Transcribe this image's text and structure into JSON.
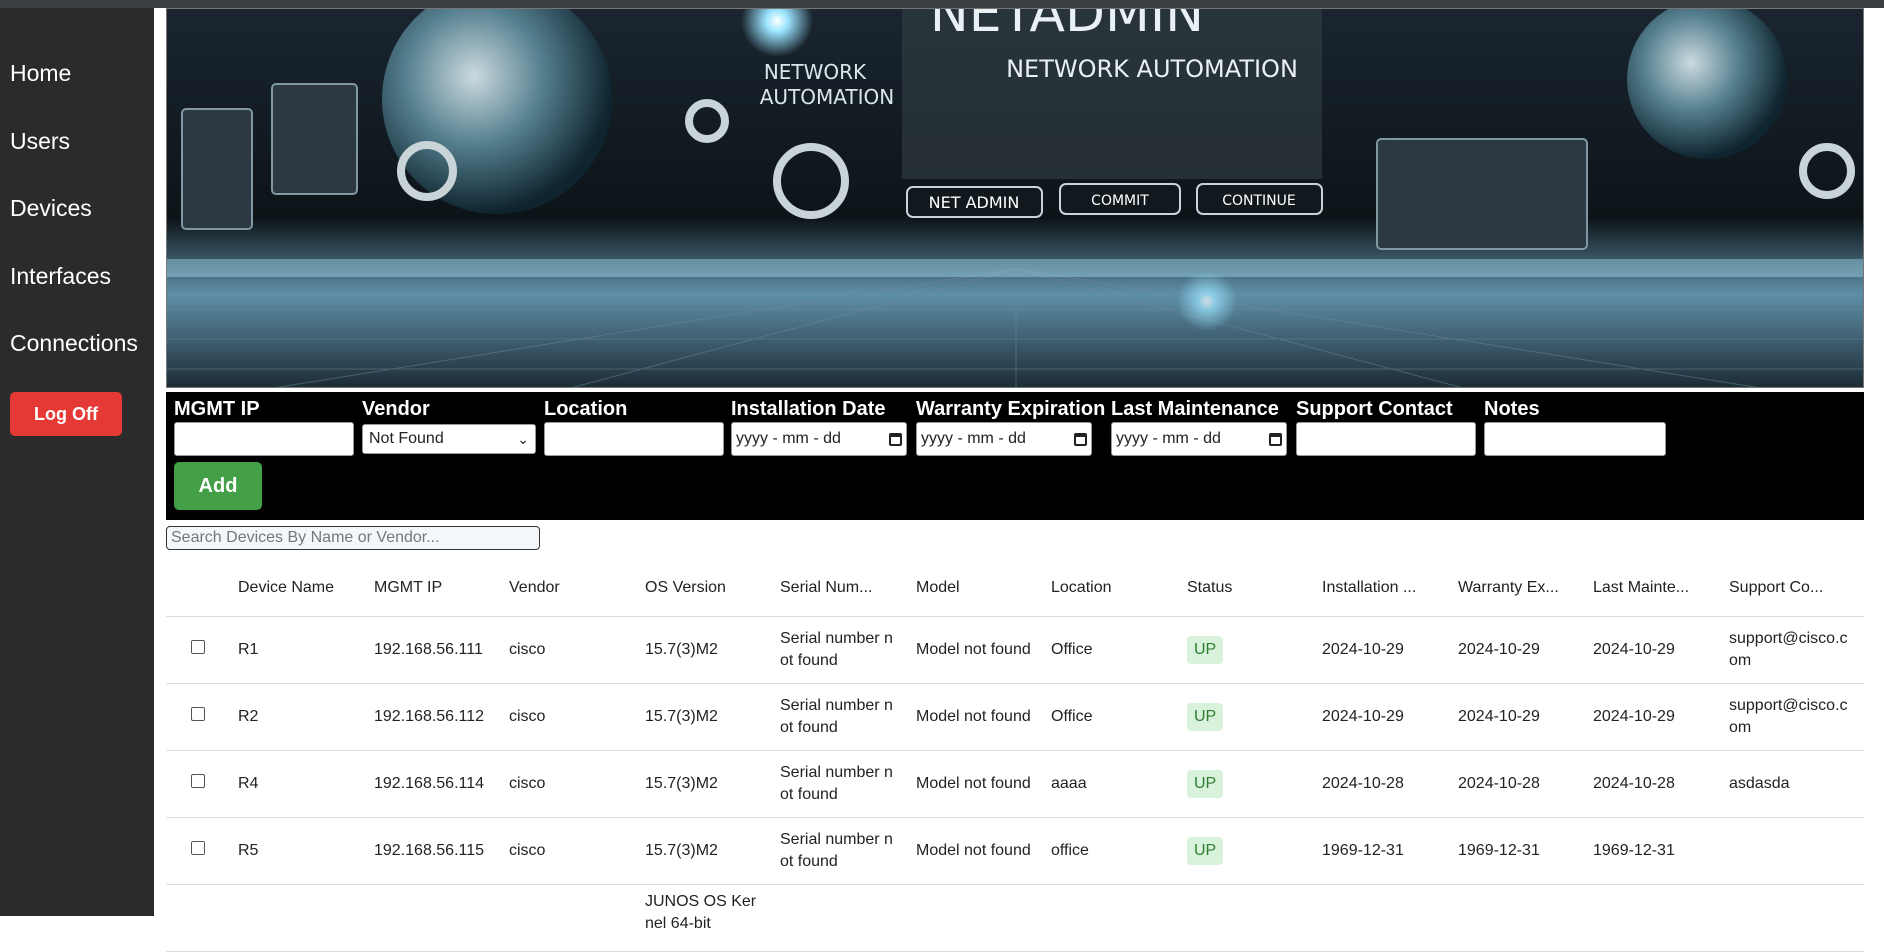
{
  "sidebar": {
    "items": [
      {
        "label": "Home"
      },
      {
        "label": "Users"
      },
      {
        "label": "Devices"
      },
      {
        "label": "Interfaces"
      },
      {
        "label": "Connections"
      }
    ],
    "logoff_label": "Log Off"
  },
  "banner": {
    "title": "NETADMIN",
    "subtitle": "NETWORK AUTOMATION",
    "left_text_line1": "NETWORK",
    "left_text_line2": "AUTOMATION",
    "buttons": [
      "NET ADMIN",
      "COMMIT",
      "CONTINUE"
    ]
  },
  "form": {
    "fields": [
      {
        "label": "MGMT IP",
        "value": ""
      },
      {
        "label": "Vendor",
        "value": "Not Found"
      },
      {
        "label": "Location",
        "value": ""
      },
      {
        "label": "Installation Date",
        "value": "yyyy - mm - dd"
      },
      {
        "label": "Warranty Expiration",
        "value": "yyyy - mm - dd"
      },
      {
        "label": "Last Maintenance",
        "value": "yyyy - mm - dd"
      },
      {
        "label": "Support Contact",
        "value": ""
      },
      {
        "label": "Notes",
        "value": ""
      }
    ],
    "add_label": "Add"
  },
  "search": {
    "placeholder": "Search Devices By Name or Vendor..."
  },
  "table": {
    "headers": [
      "Device Name",
      "MGMT IP",
      "Vendor",
      "OS Version",
      "Serial Num...",
      "Model",
      "Location",
      "Status",
      "Installation ...",
      "Warranty Ex...",
      "Last Mainte...",
      "Support Co..."
    ],
    "rows": [
      {
        "name": "R1",
        "ip": "192.168.56.111",
        "vendor": "cisco",
        "os": "15.7(3)M2",
        "serial": "Serial number not found",
        "model": "Model not found",
        "location": "Office",
        "status": "UP",
        "install": "2024-10-29",
        "warranty": "2024-10-29",
        "maint": "2024-10-29",
        "support": "support@cisco.com"
      },
      {
        "name": "R2",
        "ip": "192.168.56.112",
        "vendor": "cisco",
        "os": "15.7(3)M2",
        "serial": "Serial number not found",
        "model": "Model not found",
        "location": "Office",
        "status": "UP",
        "install": "2024-10-29",
        "warranty": "2024-10-29",
        "maint": "2024-10-29",
        "support": "support@cisco.com"
      },
      {
        "name": "R4",
        "ip": "192.168.56.114",
        "vendor": "cisco",
        "os": "15.7(3)M2",
        "serial": "Serial number not found",
        "model": "Model not found",
        "location": "aaaa",
        "status": "UP",
        "install": "2024-10-28",
        "warranty": "2024-10-28",
        "maint": "2024-10-28",
        "support": "asdasda"
      },
      {
        "name": "R5",
        "ip": "192.168.56.115",
        "vendor": "cisco",
        "os": "15.7(3)M2",
        "serial": "Serial number not found",
        "model": "Model not found",
        "location": "office",
        "status": "UP",
        "install": "1969-12-31",
        "warranty": "1969-12-31",
        "maint": "1969-12-31",
        "support": ""
      },
      {
        "name": "",
        "ip": "",
        "vendor": "",
        "os": "JUNOS OS Kernel 64-bit",
        "serial": "",
        "model": "",
        "location": "",
        "status": "",
        "install": "",
        "warranty": "",
        "maint": "",
        "support": ""
      }
    ]
  },
  "colors": {
    "sidebar_bg": "#2b2b2b",
    "logoff": "#e53935",
    "add": "#43a047",
    "form_bg": "#000000",
    "status_up_bg": "#d9f2dc",
    "status_up_text": "#2e7d32"
  }
}
